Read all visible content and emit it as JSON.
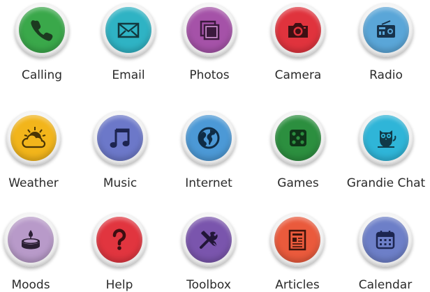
{
  "apps": [
    {
      "label": "Calling",
      "icon": "phone-icon",
      "color": "#3aa84a"
    },
    {
      "label": "Email",
      "icon": "envelope-icon",
      "color": "#2fb3c4"
    },
    {
      "label": "Photos",
      "icon": "photos-icon",
      "color": "#a552a8"
    },
    {
      "label": "Camera",
      "icon": "camera-icon",
      "color": "#e0333d"
    },
    {
      "label": "Radio",
      "icon": "radio-icon",
      "color": "#5aa6d8"
    },
    {
      "label": "Weather",
      "icon": "weather-icon",
      "color": "#f2b51b"
    },
    {
      "label": "Music",
      "icon": "music-icon",
      "color": "#6c78c9"
    },
    {
      "label": "Internet",
      "icon": "globe-icon",
      "color": "#4c99d6"
    },
    {
      "label": "Games",
      "icon": "dice-icon",
      "color": "#2c8f3f"
    },
    {
      "label": "Grandie Chat",
      "icon": "owl-icon",
      "color": "#2fb5d8"
    },
    {
      "label": "Moods",
      "icon": "candle-icon",
      "color": "#b89ac9"
    },
    {
      "label": "Help",
      "icon": "question-icon",
      "color": "#e1353f"
    },
    {
      "label": "Toolbox",
      "icon": "tools-icon",
      "color": "#7a55ad"
    },
    {
      "label": "Articles",
      "icon": "article-icon",
      "color": "#ea5a3c"
    },
    {
      "label": "Calendar",
      "icon": "calendar-icon",
      "color": "#6d7fc8"
    }
  ]
}
